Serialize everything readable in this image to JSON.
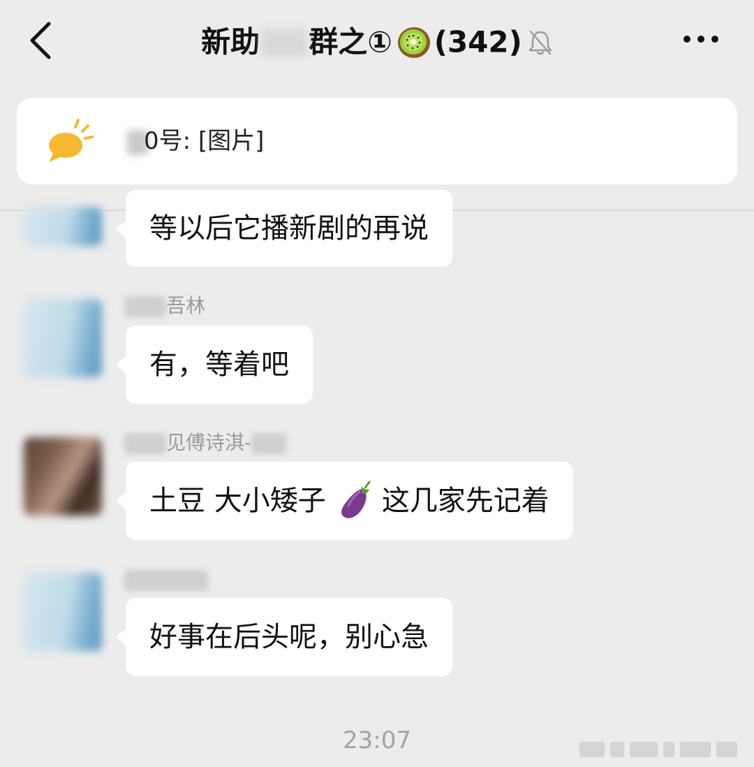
{
  "header": {
    "title_prefix": "新助",
    "title_middle": "群之",
    "title_circle": "①",
    "title_count": "(342)",
    "back_icon": "chevron-left-icon",
    "mute_icon": "bell-muted-icon",
    "more_icon": "more-dots-icon"
  },
  "notice": {
    "icon": "chat-bubble-icon",
    "text": "0号: [图片]"
  },
  "messages": [
    {
      "sender": "",
      "text": "等以后它播新剧的再说"
    },
    {
      "sender": "吾林",
      "text": "有，等着吧"
    },
    {
      "sender": "见傅诗淇-",
      "text_before": "土豆 大小矮子",
      "emoji": "eggplant-icon",
      "text_after": "这几家先记着"
    },
    {
      "sender": "",
      "text": "好事在后头呢，别心急"
    }
  ],
  "timestamp": "23:07",
  "colors": {
    "background": "#ececec",
    "bubble": "#ffffff",
    "notice_icon": "#f5b82e",
    "muted_text": "#9a9a9a"
  }
}
